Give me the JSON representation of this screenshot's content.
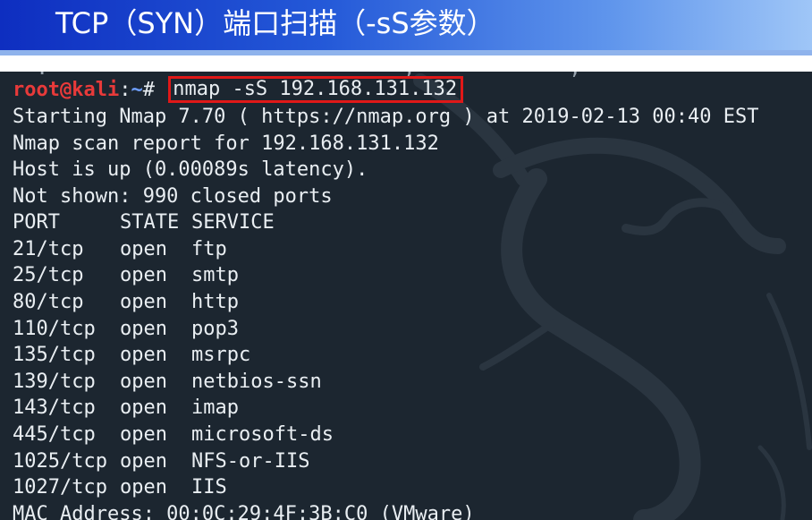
{
  "slide": {
    "title": "TCP（SYN）端口扫描（-sS参数）"
  },
  "terminal": {
    "prompt": {
      "user_host": "root@kali",
      "colon": ":",
      "path": "~",
      "symbol": "# "
    },
    "command": "nmap -sS 192.168.131.132",
    "output": [
      "Starting Nmap 7.70 ( https://nmap.org ) at 2019-02-13 00:40 EST",
      "Nmap scan report for 192.168.131.132",
      "Host is up (0.00089s latency).",
      "Not shown: 990 closed ports"
    ],
    "table_header": {
      "port": "PORT",
      "state": "STATE",
      "service": "SERVICE"
    },
    "ports": [
      {
        "port": "21/tcp",
        "state": "open",
        "service": "ftp"
      },
      {
        "port": "25/tcp",
        "state": "open",
        "service": "smtp"
      },
      {
        "port": "80/tcp",
        "state": "open",
        "service": "http"
      },
      {
        "port": "110/tcp",
        "state": "open",
        "service": "pop3"
      },
      {
        "port": "135/tcp",
        "state": "open",
        "service": "msrpc"
      },
      {
        "port": "139/tcp",
        "state": "open",
        "service": "netbios-ssn"
      },
      {
        "port": "143/tcp",
        "state": "open",
        "service": "imap"
      },
      {
        "port": "445/tcp",
        "state": "open",
        "service": "microsoft-ds"
      },
      {
        "port": "1025/tcp",
        "state": "open",
        "service": "NFS-or-IIS"
      },
      {
        "port": "1027/tcp",
        "state": "open",
        "service": "IIS"
      }
    ],
    "mac_line": "MAC Address: 00:0C:29:4F:3B:C0 (VMware)"
  },
  "colors": {
    "header_gradient_start": "#0e2ec0",
    "header_gradient_end": "#9fc6f7",
    "terminal_background": "#1c2630",
    "terminal_text": "#e9eef2",
    "prompt_user": "#e83a3a",
    "prompt_path": "#6fa0ff",
    "highlight_box": "#e01818"
  },
  "icons": {
    "background_watermark": "kali-dragon-icon"
  }
}
